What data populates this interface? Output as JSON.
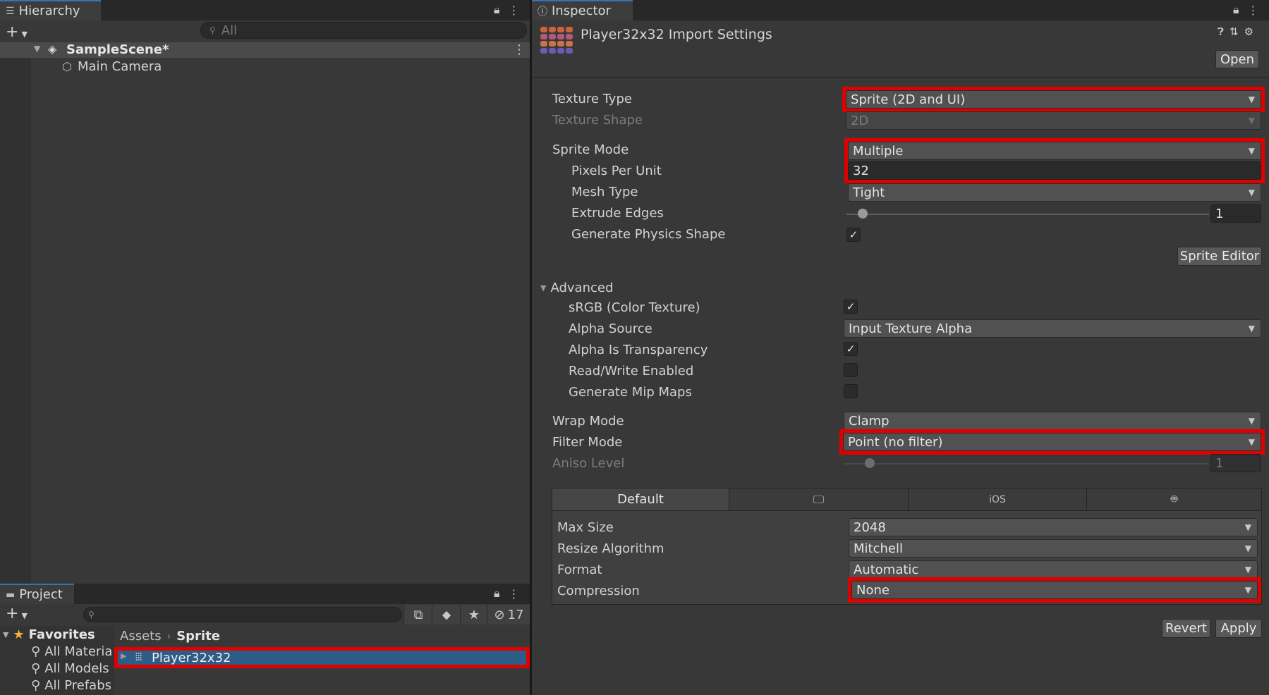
{
  "hierarchy": {
    "tab_label": "Hierarchy",
    "search_placeholder": "All",
    "scene_name": "SampleScene*",
    "items": [
      "Main Camera"
    ]
  },
  "project": {
    "tab_label": "Project",
    "hidden_count": "17",
    "favorites_label": "Favorites",
    "favorites": [
      "All Materia",
      "All Models",
      "All Prefabs"
    ],
    "breadcrumb": [
      "Assets",
      "Sprite"
    ],
    "asset_name": "Player32x32"
  },
  "inspector": {
    "tab_label": "Inspector",
    "title": "Player32x32 Import Settings",
    "open_label": "Open",
    "texture_type_label": "Texture Type",
    "texture_type_value": "Sprite (2D and UI)",
    "texture_shape_label": "Texture Shape",
    "texture_shape_value": "2D",
    "sprite_mode_label": "Sprite Mode",
    "sprite_mode_value": "Multiple",
    "ppu_label": "Pixels Per Unit",
    "ppu_value": "32",
    "mesh_type_label": "Mesh Type",
    "mesh_type_value": "Tight",
    "extrude_label": "Extrude Edges",
    "extrude_value": "1",
    "physics_label": "Generate Physics Shape",
    "sprite_editor_label": "Sprite Editor",
    "advanced_label": "Advanced",
    "srgb_label": "sRGB (Color Texture)",
    "alpha_source_label": "Alpha Source",
    "alpha_source_value": "Input Texture Alpha",
    "alpha_transp_label": "Alpha Is Transparency",
    "readwrite_label": "Read/Write Enabled",
    "mipmaps_label": "Generate Mip Maps",
    "wrap_label": "Wrap Mode",
    "wrap_value": "Clamp",
    "filter_label": "Filter Mode",
    "filter_value": "Point (no filter)",
    "aniso_label": "Aniso Level",
    "aniso_value": "1",
    "platform_tabs": {
      "default": "Default",
      "ios": "iOS"
    },
    "max_size_label": "Max Size",
    "max_size_value": "2048",
    "resize_label": "Resize Algorithm",
    "resize_value": "Mitchell",
    "format_label": "Format",
    "format_value": "Automatic",
    "compression_label": "Compression",
    "compression_value": "None",
    "revert_label": "Revert",
    "apply_label": "Apply"
  },
  "settings": {
    "srgb": true,
    "alpha_is_transparency": true,
    "read_write": false,
    "mip_maps": false,
    "physics_shape": true,
    "extrude_slider_fraction": 0.0,
    "aniso_slider_fraction": 0.06
  },
  "colors": {
    "highlight": "#e00000",
    "tab_accent": "#3a72b0",
    "selection": "#2c5d87"
  }
}
